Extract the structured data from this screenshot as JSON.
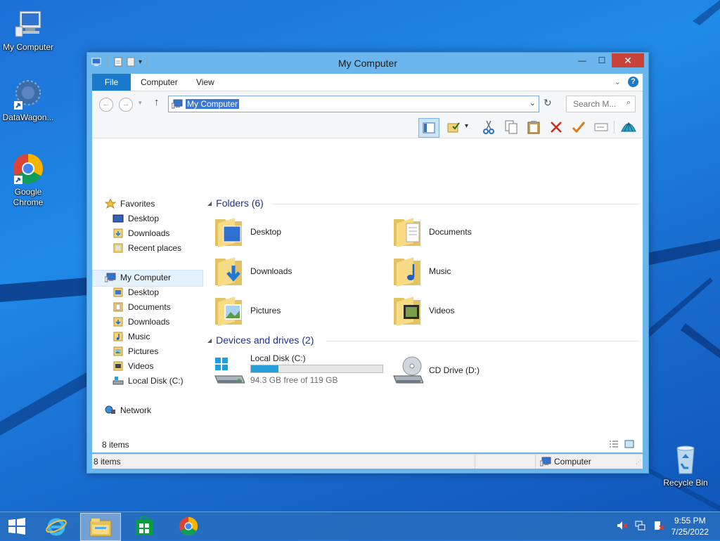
{
  "desktop": {
    "icons": [
      {
        "label": "My Computer"
      },
      {
        "label": "DataWagon..."
      },
      {
        "label": "Google Chrome"
      },
      {
        "label": "Recycle Bin"
      }
    ]
  },
  "window": {
    "title": "My Computer",
    "controls": {
      "minimize": "—",
      "maximize": "☐",
      "close": "✕"
    },
    "ribbon_tabs": [
      "File",
      "Computer",
      "View"
    ],
    "address": "My Computer",
    "search_placeholder": "Search M...",
    "sidebar": {
      "favorites": {
        "title": "Favorites",
        "items": [
          "Desktop",
          "Downloads",
          "Recent places"
        ]
      },
      "computer": {
        "title": "My Computer",
        "items": [
          "Desktop",
          "Documents",
          "Downloads",
          "Music",
          "Pictures",
          "Videos",
          "Local Disk (C:)"
        ]
      },
      "network": {
        "title": "Network"
      }
    },
    "folders_group": {
      "title": "Folders (6)",
      "items": [
        "Desktop",
        "Documents",
        "Downloads",
        "Music",
        "Pictures",
        "Videos"
      ]
    },
    "drives_group": {
      "title": "Devices and drives (2)",
      "drives": [
        {
          "name": "Local Disk (C:)",
          "free_text": "94.3 GB free of 119 GB",
          "used_fraction": 0.21
        },
        {
          "name": "CD Drive (D:)"
        }
      ]
    },
    "status": {
      "items_count": "8 items",
      "items_count_bar": "8 items",
      "location": "Computer"
    }
  },
  "taskbar": {
    "time": "9:55 PM",
    "date": "7/25/2022"
  },
  "colors": {
    "accent": "#1979ca",
    "close": "#c7433a",
    "progress": "#26a0da"
  }
}
